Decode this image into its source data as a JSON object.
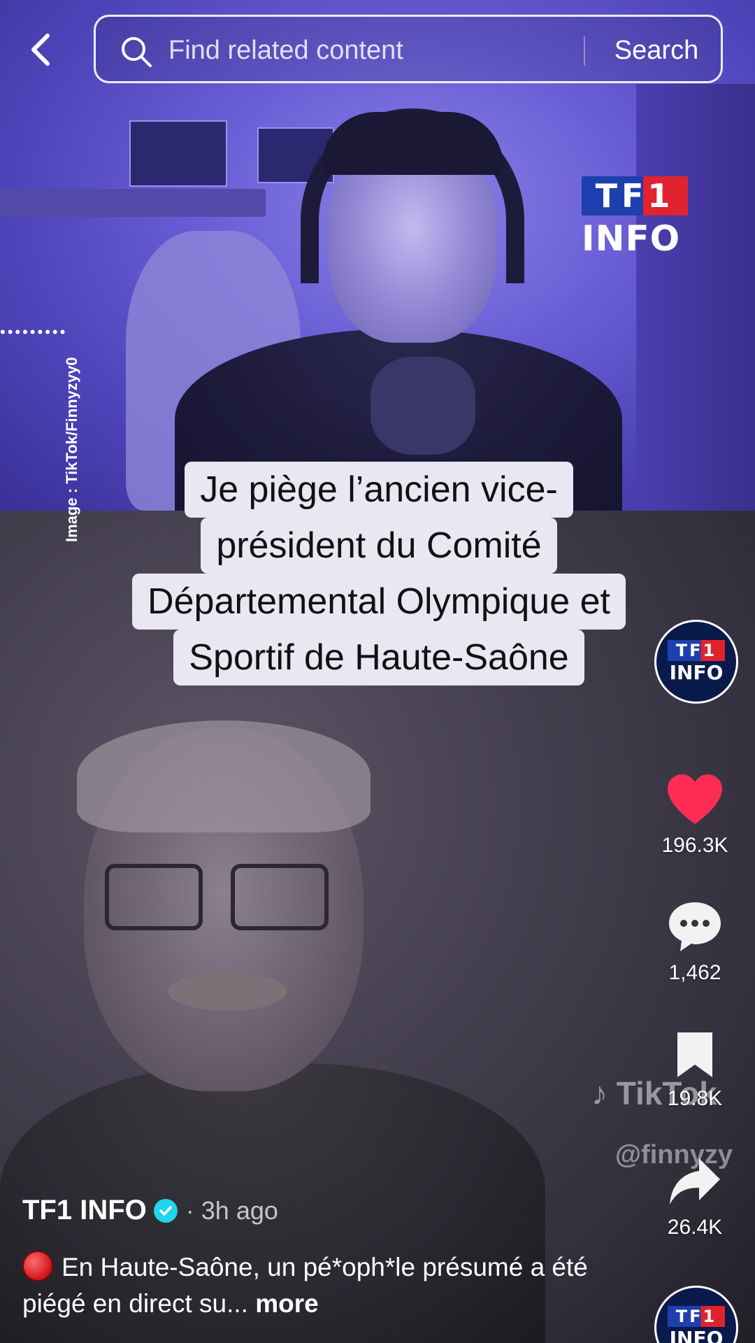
{
  "search": {
    "placeholder": "Find related content",
    "button_label": "Search"
  },
  "video": {
    "logo_top": "TF1",
    "logo_bottom": "INFO",
    "credit": "Image : TikTok/Finnyzyy0",
    "caption_lines": [
      "Je piège l’ancien vice-",
      "président du Comité",
      "Départemental Olympique et",
      "Sportif de Haute-Saône"
    ],
    "watermark_brand": "TikTok",
    "watermark_handle": "@finnyzy"
  },
  "rail": {
    "avatar_top": "TF1",
    "avatar_bottom": "INFO",
    "likes": "196.3K",
    "comments": "1,462",
    "saves": "19.8K",
    "shares": "26.4K"
  },
  "post": {
    "author": "TF1 INFO",
    "time_ago": "· 3h ago",
    "description": "En Haute-Saône, un pé*oph*le présumé a été piégé en direct su...",
    "more_label": "more"
  },
  "colors": {
    "like_heart": "#ff2d55",
    "verified": "#20d5ec",
    "tf1_blue": "#1e3fae",
    "tf1_red": "#e0232e"
  }
}
